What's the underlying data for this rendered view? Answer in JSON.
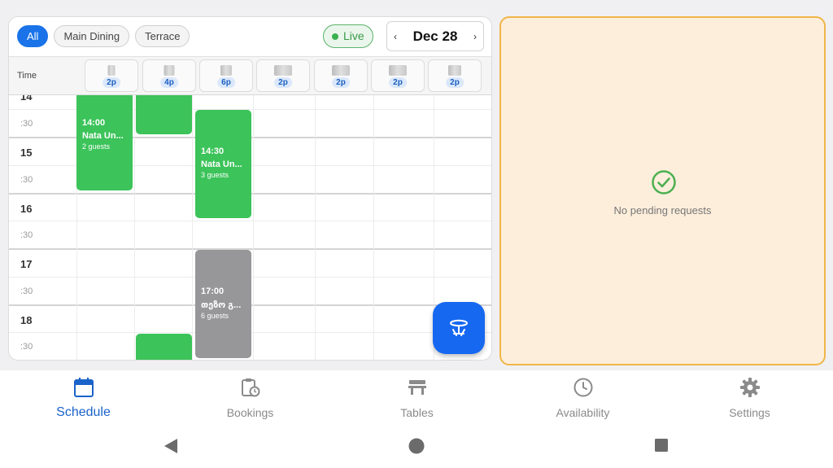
{
  "filters": [
    "All",
    "Main Dining",
    "Terrace"
  ],
  "live_label": "Live",
  "date": {
    "prev": "‹",
    "label": "Dec 28",
    "next": "›"
  },
  "table_header": {
    "time_label": "Time",
    "columns": [
      "2p",
      "4p",
      "6p",
      "2p",
      "2p",
      "2p",
      "2p"
    ]
  },
  "rows": [
    {
      "label": "14"
    },
    {
      "label": ":30"
    },
    {
      "label": "15"
    },
    {
      "label": ":30"
    },
    {
      "label": "16"
    },
    {
      "label": ":30"
    },
    {
      "label": "17"
    },
    {
      "label": ":30"
    },
    {
      "label": "18"
    },
    {
      "label": ":30"
    }
  ],
  "reservations": [
    {
      "time": "14:00",
      "name": "Nata Un...",
      "guests": "2 guests",
      "status": "confirmed"
    },
    {
      "time": "14:30",
      "name": "Nata Un...",
      "guests": "3 guests",
      "status": "confirmed"
    },
    {
      "time": "17:00",
      "name": "თეზო გ...",
      "guests": "6 guests",
      "status": "completed"
    }
  ],
  "requests": {
    "empty_message": "No pending requests"
  },
  "bottom_nav": [
    {
      "label": "Schedule",
      "icon": "calendar-icon",
      "active": true
    },
    {
      "label": "Bookings",
      "icon": "clipboard-clock-icon",
      "active": false
    },
    {
      "label": "Tables",
      "icon": "table-icon",
      "active": false
    },
    {
      "label": "Availability",
      "icon": "clock-icon",
      "active": false
    },
    {
      "label": "Settings",
      "icon": "gear-icon",
      "active": false
    }
  ],
  "colors": {
    "primary": "#1a73e8",
    "confirmed": "#3cc35a",
    "completed": "#97979a",
    "panel_bg": "#fdeedb",
    "panel_border": "#f0b548",
    "success": "#4caf50"
  }
}
